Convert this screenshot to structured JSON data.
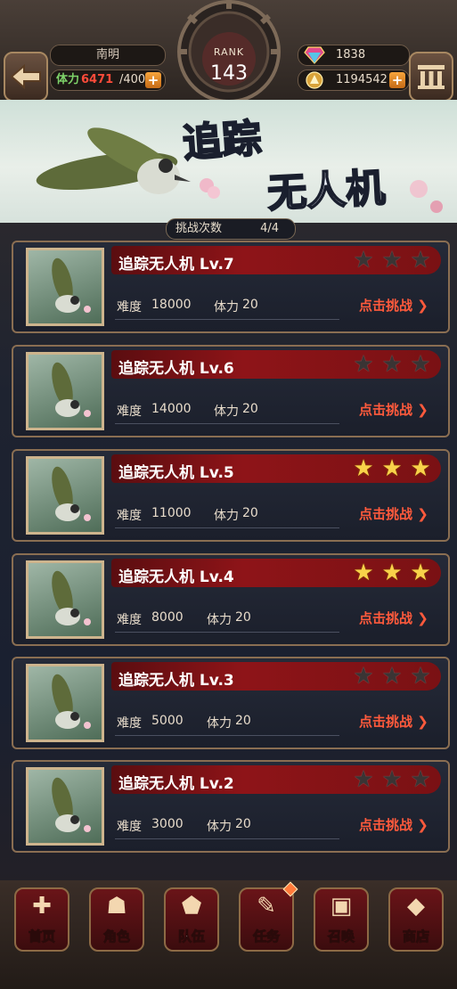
{
  "header": {
    "player_name": "南明",
    "stamina_label": "体力",
    "stamina_current": "6471",
    "stamina_max": "/400",
    "rank_label": "RANK",
    "rank_value": "143",
    "gems": "1838",
    "gold": "1194542",
    "plus_label": "+"
  },
  "banner": {
    "title_line1": "追踪",
    "title_line2": "无人机"
  },
  "attempts": {
    "label": "挑战次数",
    "value": "4/4"
  },
  "stages": [
    {
      "title": "追踪无人机 Lv.7",
      "difficulty_label": "难度",
      "difficulty": "18000",
      "stamina_label": "体力",
      "stamina": "20",
      "stars": 0,
      "action": "点击挑战 ❯"
    },
    {
      "title": "追踪无人机 Lv.6",
      "difficulty_label": "难度",
      "difficulty": "14000",
      "stamina_label": "体力",
      "stamina": "20",
      "stars": 0,
      "action": "点击挑战 ❯"
    },
    {
      "title": "追踪无人机 Lv.5",
      "difficulty_label": "难度",
      "difficulty": "11000",
      "stamina_label": "体力",
      "stamina": "20",
      "stars": 3,
      "action": "点击挑战 ❯"
    },
    {
      "title": "追踪无人机 Lv.4",
      "difficulty_label": "难度",
      "difficulty": "8000",
      "stamina_label": "体力",
      "stamina": "20",
      "stars": 3,
      "action": "点击挑战 ❯"
    },
    {
      "title": "追踪无人机 Lv.3",
      "difficulty_label": "难度",
      "difficulty": "5000",
      "stamina_label": "体力",
      "stamina": "20",
      "stars": 0,
      "action": "点击挑战 ❯"
    },
    {
      "title": "追踪无人机 Lv.2",
      "difficulty_label": "难度",
      "difficulty": "3000",
      "stamina_label": "体力",
      "stamina": "20",
      "stars": 0,
      "action": "点击挑战 ❯"
    }
  ],
  "nav": [
    {
      "label": "首页",
      "icon": "home-icon",
      "glyph": "✚"
    },
    {
      "label": "角色",
      "icon": "character-icon",
      "glyph": "☗"
    },
    {
      "label": "队伍",
      "icon": "team-icon",
      "glyph": "⬟"
    },
    {
      "label": "任务",
      "icon": "quest-icon",
      "glyph": "✎"
    },
    {
      "label": "召唤",
      "icon": "summon-icon",
      "glyph": "▣"
    },
    {
      "label": "商店",
      "icon": "shop-icon",
      "glyph": "◆"
    }
  ],
  "colors": {
    "accent_red": "#8e1418",
    "challenge_text": "#ff5a3c",
    "star_on": "#f8d24a",
    "stamina_current": "#ff4b3a"
  }
}
